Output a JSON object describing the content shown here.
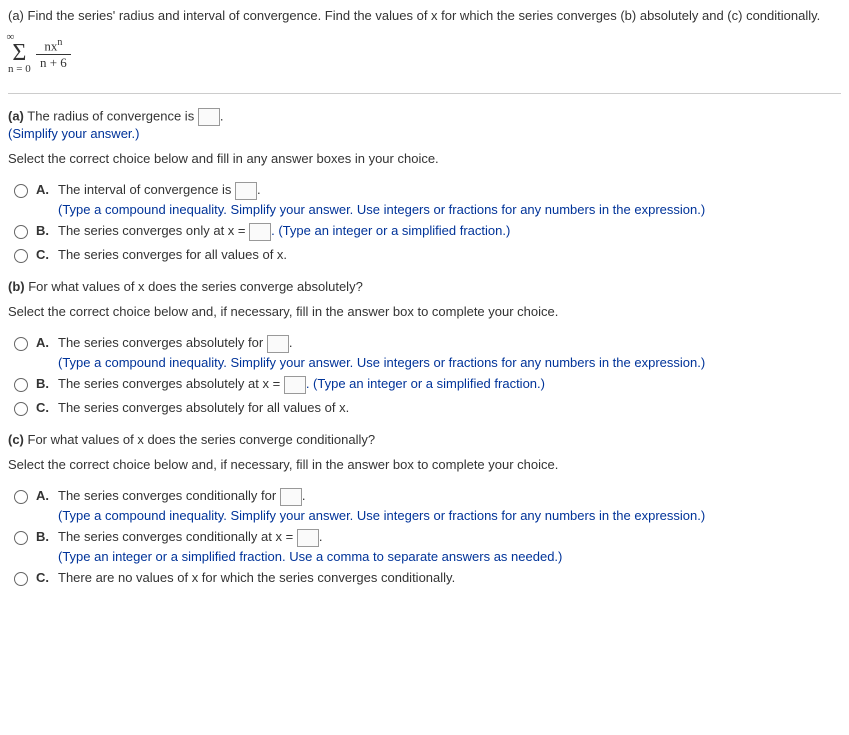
{
  "q_intro": "(a) Find the series' radius and interval of convergence. Find the values of x for which the series converges (b) absolutely and (c) conditionally.",
  "formula": {
    "top": "∞",
    "sigma": "Σ",
    "bottom": "n = 0",
    "numerator_a": "nx",
    "numerator_exp": "n",
    "denominator": "n + 6"
  },
  "part_a": {
    "prefix": "(a)",
    "text": " The radius of convergence is ",
    "period": ".",
    "hint": "(Simplify your answer.)",
    "select_text": "Select the correct choice below and fill in any answer boxes in your choice.",
    "A": {
      "letter": "A.",
      "line1a": "The interval of convergence is ",
      "line1b": ".",
      "line2": "(Type a compound inequality. Simplify your answer. Use integers or fractions for any numbers in the expression.)"
    },
    "B": {
      "letter": "B.",
      "line1a": "The series converges only at x = ",
      "line1b": ". (Type an integer or a simplified fraction.)"
    },
    "C": {
      "letter": "C.",
      "line1": "The series converges for all values of x."
    }
  },
  "part_b": {
    "heading": "(b) For what values of x does the series converge absolutely?",
    "select_text": "Select the correct choice below and, if necessary, fill in the answer box to complete your choice.",
    "A": {
      "letter": "A.",
      "line1a": "The series converges absolutely for ",
      "line1b": ".",
      "line2": "(Type a compound inequality. Simplify your answer. Use integers or fractions for any numbers in the expression.)"
    },
    "B": {
      "letter": "B.",
      "line1a": "The series converges absolutely at x = ",
      "line1b": ". (Type an integer or a simplified fraction.)"
    },
    "C": {
      "letter": "C.",
      "line1": "The series converges absolutely for all values of x."
    }
  },
  "part_c": {
    "heading": "(c) For what values of x does the series converge conditionally?",
    "select_text": "Select the correct choice below and, if necessary, fill in the answer box to complete your choice.",
    "A": {
      "letter": "A.",
      "line1a": "The series converges conditionally for ",
      "line1b": ".",
      "line2": "(Type a compound inequality. Simplify your answer. Use integers or fractions for any numbers in the expression.)"
    },
    "B": {
      "letter": "B.",
      "line1a": "The series converges conditionally at x = ",
      "line1b": ".",
      "line2": "(Type an integer or a simplified fraction. Use a comma to separate answers as needed.)"
    },
    "C": {
      "letter": "C.",
      "line1": "There are no values of x for which the series converges conditionally."
    }
  }
}
